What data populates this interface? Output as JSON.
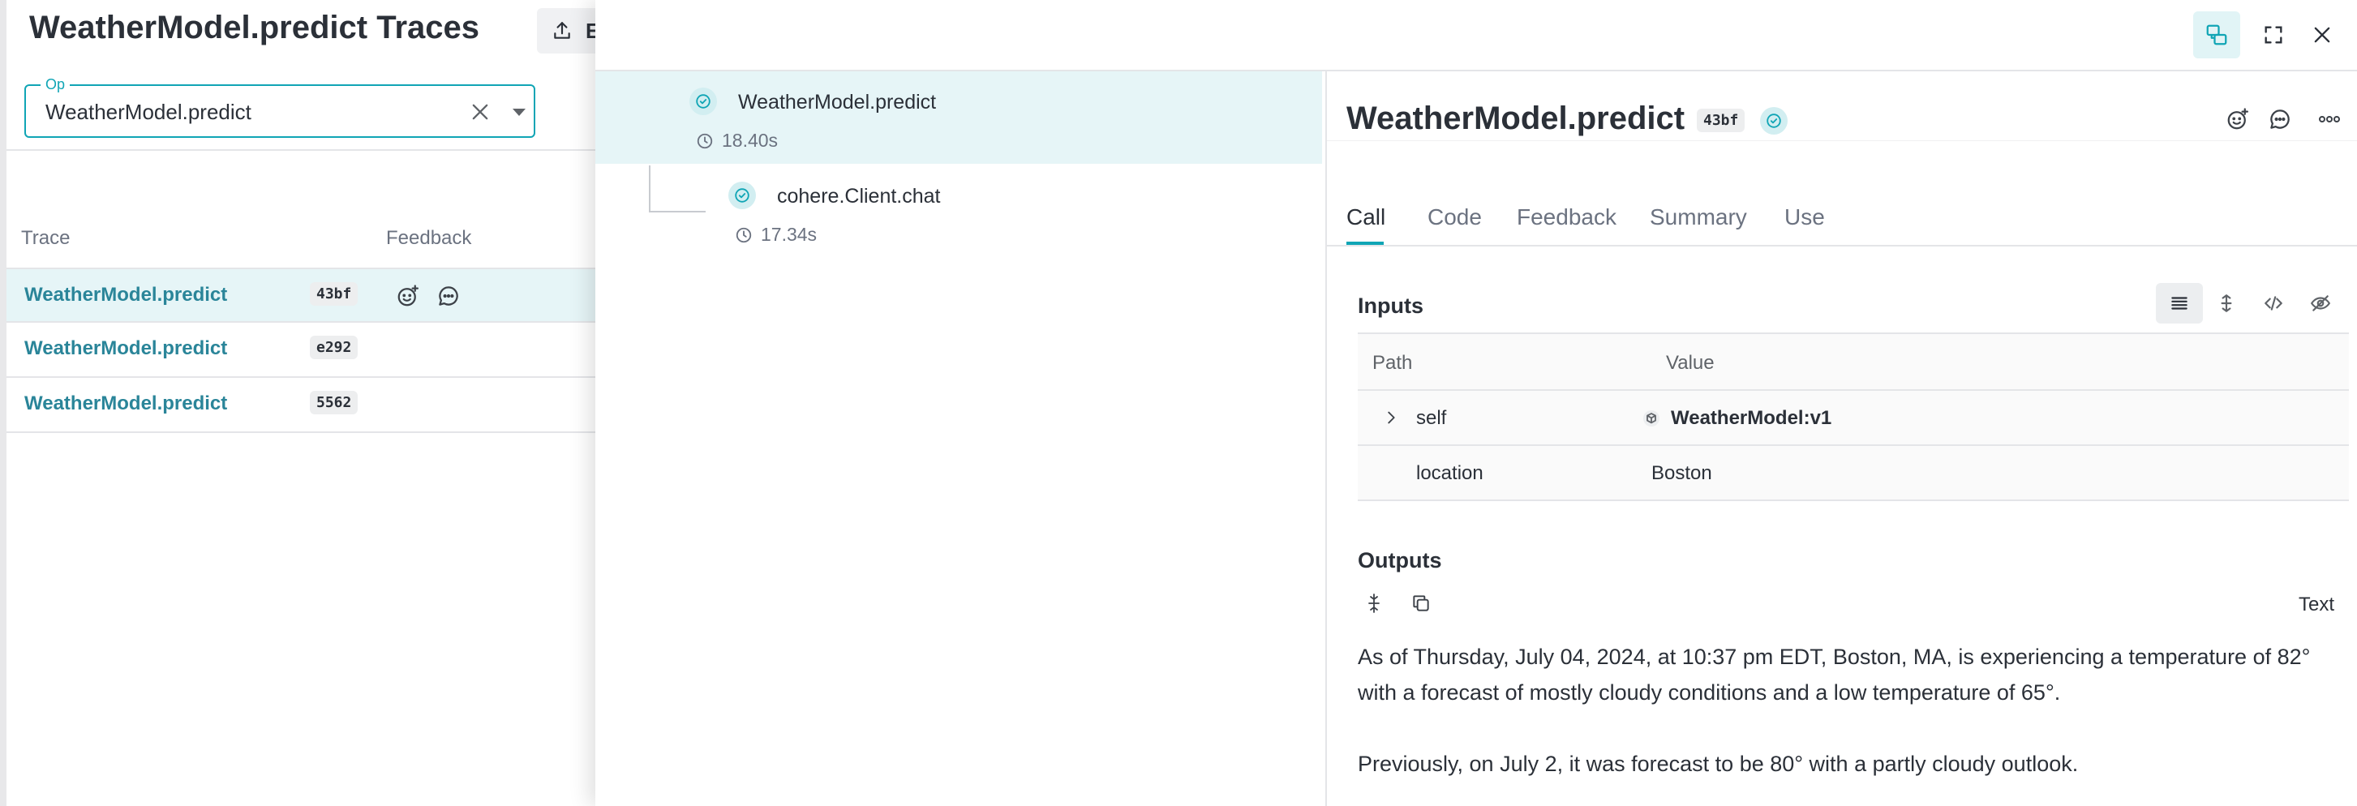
{
  "traces_page": {
    "title": "WeatherModel.predict Traces",
    "export_label": "E",
    "op_filter": {
      "label": "Op",
      "value": "WeatherModel.predict"
    },
    "columns": {
      "trace": "Trace",
      "feedback": "Feedback"
    },
    "rows": [
      {
        "name": "WeatherModel.predict",
        "id": "43bf"
      },
      {
        "name": "WeatherModel.predict",
        "id": "e292"
      },
      {
        "name": "WeatherModel.predict",
        "id": "5562"
      }
    ]
  },
  "trace_tree": {
    "nodes": [
      {
        "name": "WeatherModel.predict",
        "duration": "18.40s"
      },
      {
        "name": "cohere.Client.chat",
        "duration": "17.34s"
      }
    ]
  },
  "call": {
    "title": "WeatherModel.predict",
    "id_badge": "43bf",
    "tabs": [
      "Call",
      "Code",
      "Feedback",
      "Summary",
      "Use"
    ],
    "active_tab": "Call",
    "inputs": {
      "title": "Inputs",
      "columns": {
        "path": "Path",
        "value": "Value"
      },
      "rows": [
        {
          "path": "self",
          "value": "WeatherModel:v1"
        },
        {
          "path": "location",
          "value": "Boston"
        }
      ]
    },
    "outputs": {
      "title": "Outputs",
      "format": "Text",
      "paragraphs": [
        "As of Thursday, July 04, 2024, at 10:37 pm EDT, Boston, MA, is experiencing a temperature of 82° with a forecast of mostly cloudy conditions and a low temperature of 65°.",
        "Previously, on July 2, it was forecast to be 80° with a partly cloudy outlook."
      ]
    }
  },
  "colors": {
    "accent": "#10a5b5",
    "link": "#2a8599",
    "selected_row": "#e6f5f7"
  }
}
